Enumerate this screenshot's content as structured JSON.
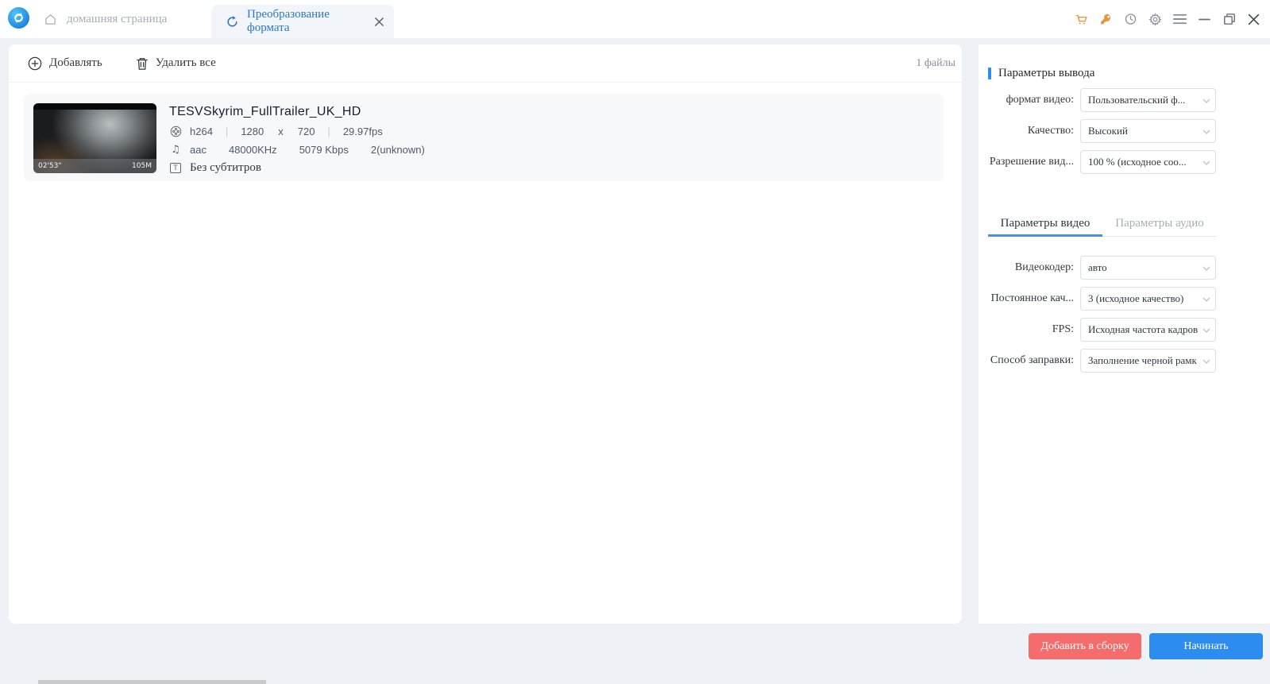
{
  "header": {
    "home_tab_label": "домашняя страница",
    "active_tab_label": "Преобразование формата"
  },
  "toolbar": {
    "add_label": "Добавлять",
    "delete_all_label": "Удалить все",
    "file_count": "1 файлы"
  },
  "file_item": {
    "title": "TESVSkyrim_FullTrailer_UK_HD",
    "duration": "02'53\"",
    "size": "105M",
    "video": {
      "codec": "h264",
      "width": "1280",
      "times": "x",
      "height": "720",
      "fps": "29.97fps",
      "separator": "|"
    },
    "audio": {
      "codec": "aac",
      "sample_rate": "48000KHz",
      "bitrate": "5079 Kbps",
      "channels": "2(unknown)"
    },
    "subtitle_label": "Без субтитров"
  },
  "output_panel": {
    "title": "Параметры вывода",
    "fields": [
      {
        "label": "формат видео:",
        "value": "Пользовательский ф..."
      },
      {
        "label": "Качество:",
        "value": "Высокий"
      },
      {
        "label": "Разрешение вид...",
        "value": "100 % (исходное соо..."
      }
    ],
    "tabs": [
      {
        "label": "Параметры видео"
      },
      {
        "label": "Параметры аудио"
      }
    ],
    "video_fields": [
      {
        "label": "Видеокодер:",
        "value": "авто"
      },
      {
        "label": "Постоянное кач...",
        "value": "3 (исходное качество)"
      },
      {
        "label": "FPS:",
        "value": "Исходная частота кадров"
      },
      {
        "label": "Способ заправки:",
        "value": "Заполнение черной рамк"
      }
    ]
  },
  "footer": {
    "add_to_queue_label": "Добавить в сборку",
    "start_label": "Начинать"
  },
  "icons": {
    "music_note": "♫",
    "subtitle_glyph": "T"
  },
  "colors": {
    "accent_blue": "#2d8cf0",
    "tab_text_blue": "#2e77c6",
    "danger_red": "#f56c6c",
    "orange_icon": "#e8963e",
    "gray_icon": "#8a9099"
  }
}
